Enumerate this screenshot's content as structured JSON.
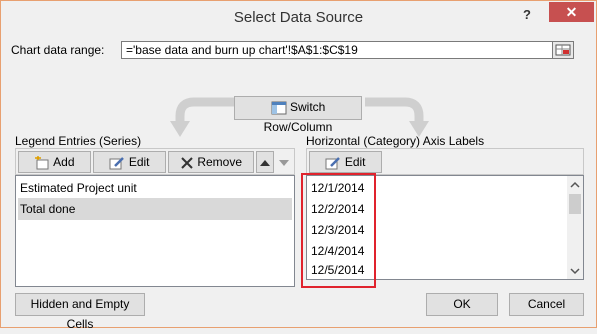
{
  "dialog": {
    "title": "Select Data Source",
    "help": "?",
    "close": "✕"
  },
  "chart_range": {
    "label": "Chart data range:",
    "value": "='base data and burn up chart'!$A$1:$C$19"
  },
  "switch_button": {
    "label": "Switch Row/Column"
  },
  "legend": {
    "heading": "Legend Entries (Series)",
    "add_label": "Add",
    "edit_label": "Edit",
    "remove_label": "Remove",
    "items": [
      {
        "label": "Estimated Project unit",
        "selected": false
      },
      {
        "label": "Total done",
        "selected": true
      }
    ]
  },
  "axis": {
    "heading": "Horizontal (Category) Axis Labels",
    "edit_label": "Edit",
    "items": [
      "12/1/2014",
      "12/2/2014",
      "12/3/2014",
      "12/4/2014",
      "12/5/2014"
    ]
  },
  "footer": {
    "hidden_cells_label": "Hidden and Empty Cells",
    "ok_label": "OK",
    "cancel_label": "Cancel"
  }
}
